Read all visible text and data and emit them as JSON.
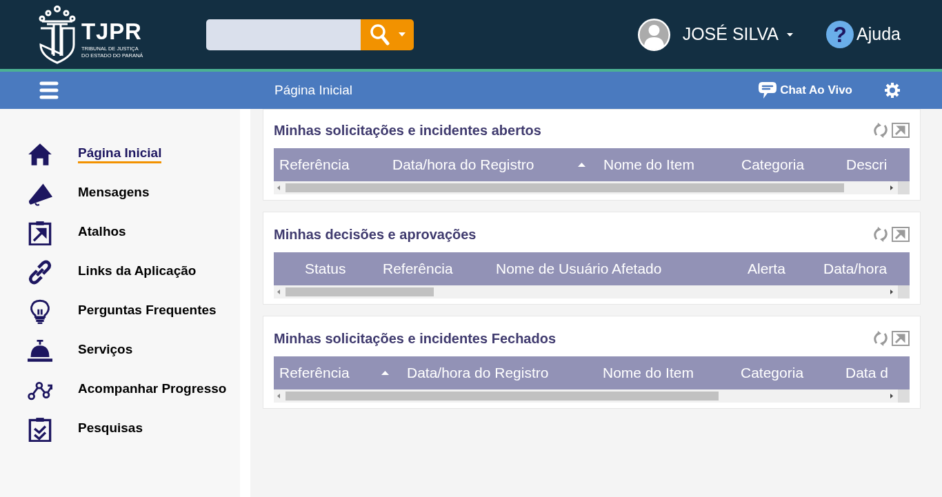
{
  "header": {
    "logo_text": "TJPR",
    "logo_subtitle_1": "TRIBUNAL DE JUSTIÇA",
    "logo_subtitle_2": "DO ESTADO DO PARANÁ",
    "user_name": "JOSÉ SILVA",
    "help_label": "Ajuda",
    "help_glyph": "?"
  },
  "nav_bar": {
    "page_title": "Página Inicial",
    "chat_label": "Chat Ao Vivo"
  },
  "sidebar": {
    "items": [
      {
        "label": "Página Inicial",
        "kind": "home",
        "selected": true
      },
      {
        "label": "Mensagens",
        "kind": "megaphone",
        "selected": false
      },
      {
        "label": "Atalhos",
        "kind": "shortcut",
        "selected": false
      },
      {
        "label": "Links da Aplicação",
        "kind": "link",
        "selected": false
      },
      {
        "label": "Perguntas Frequentes",
        "kind": "bulb",
        "selected": false
      },
      {
        "label": "Serviços",
        "kind": "bell",
        "selected": false
      },
      {
        "label": "Acompanhar Progresso",
        "kind": "progress",
        "selected": false
      },
      {
        "label": "Pesquisas",
        "kind": "survey",
        "selected": false
      }
    ]
  },
  "panels": [
    {
      "title": "Minhas solicitações e incidentes abertos",
      "columns": [
        {
          "label": "Referência",
          "sorted": false
        },
        {
          "label": "Data/hora do Registro",
          "sorted": true
        },
        {
          "label": "Nome do Item",
          "sorted": false
        },
        {
          "label": "Categoria",
          "sorted": false
        },
        {
          "label": "Descri",
          "sorted": false
        }
      ]
    },
    {
      "title": "Minhas decisões e aprovações",
      "columns": [
        {
          "label": "Status",
          "sorted": false
        },
        {
          "label": "Referência",
          "sorted": false
        },
        {
          "label": "Nome de Usuário Afetado",
          "sorted": false
        },
        {
          "label": "Alerta",
          "sorted": false
        },
        {
          "label": "Data/hora",
          "sorted": false
        }
      ]
    },
    {
      "title": "Minhas solicitações e incidentes Fechados",
      "columns": [
        {
          "label": "Referência",
          "sorted": true
        },
        {
          "label": "Data/hora do Registro",
          "sorted": false
        },
        {
          "label": "Nome do Item",
          "sorted": false
        },
        {
          "label": "Categoria",
          "sorted": false
        },
        {
          "label": "Data d",
          "sorted": false
        }
      ]
    }
  ]
}
